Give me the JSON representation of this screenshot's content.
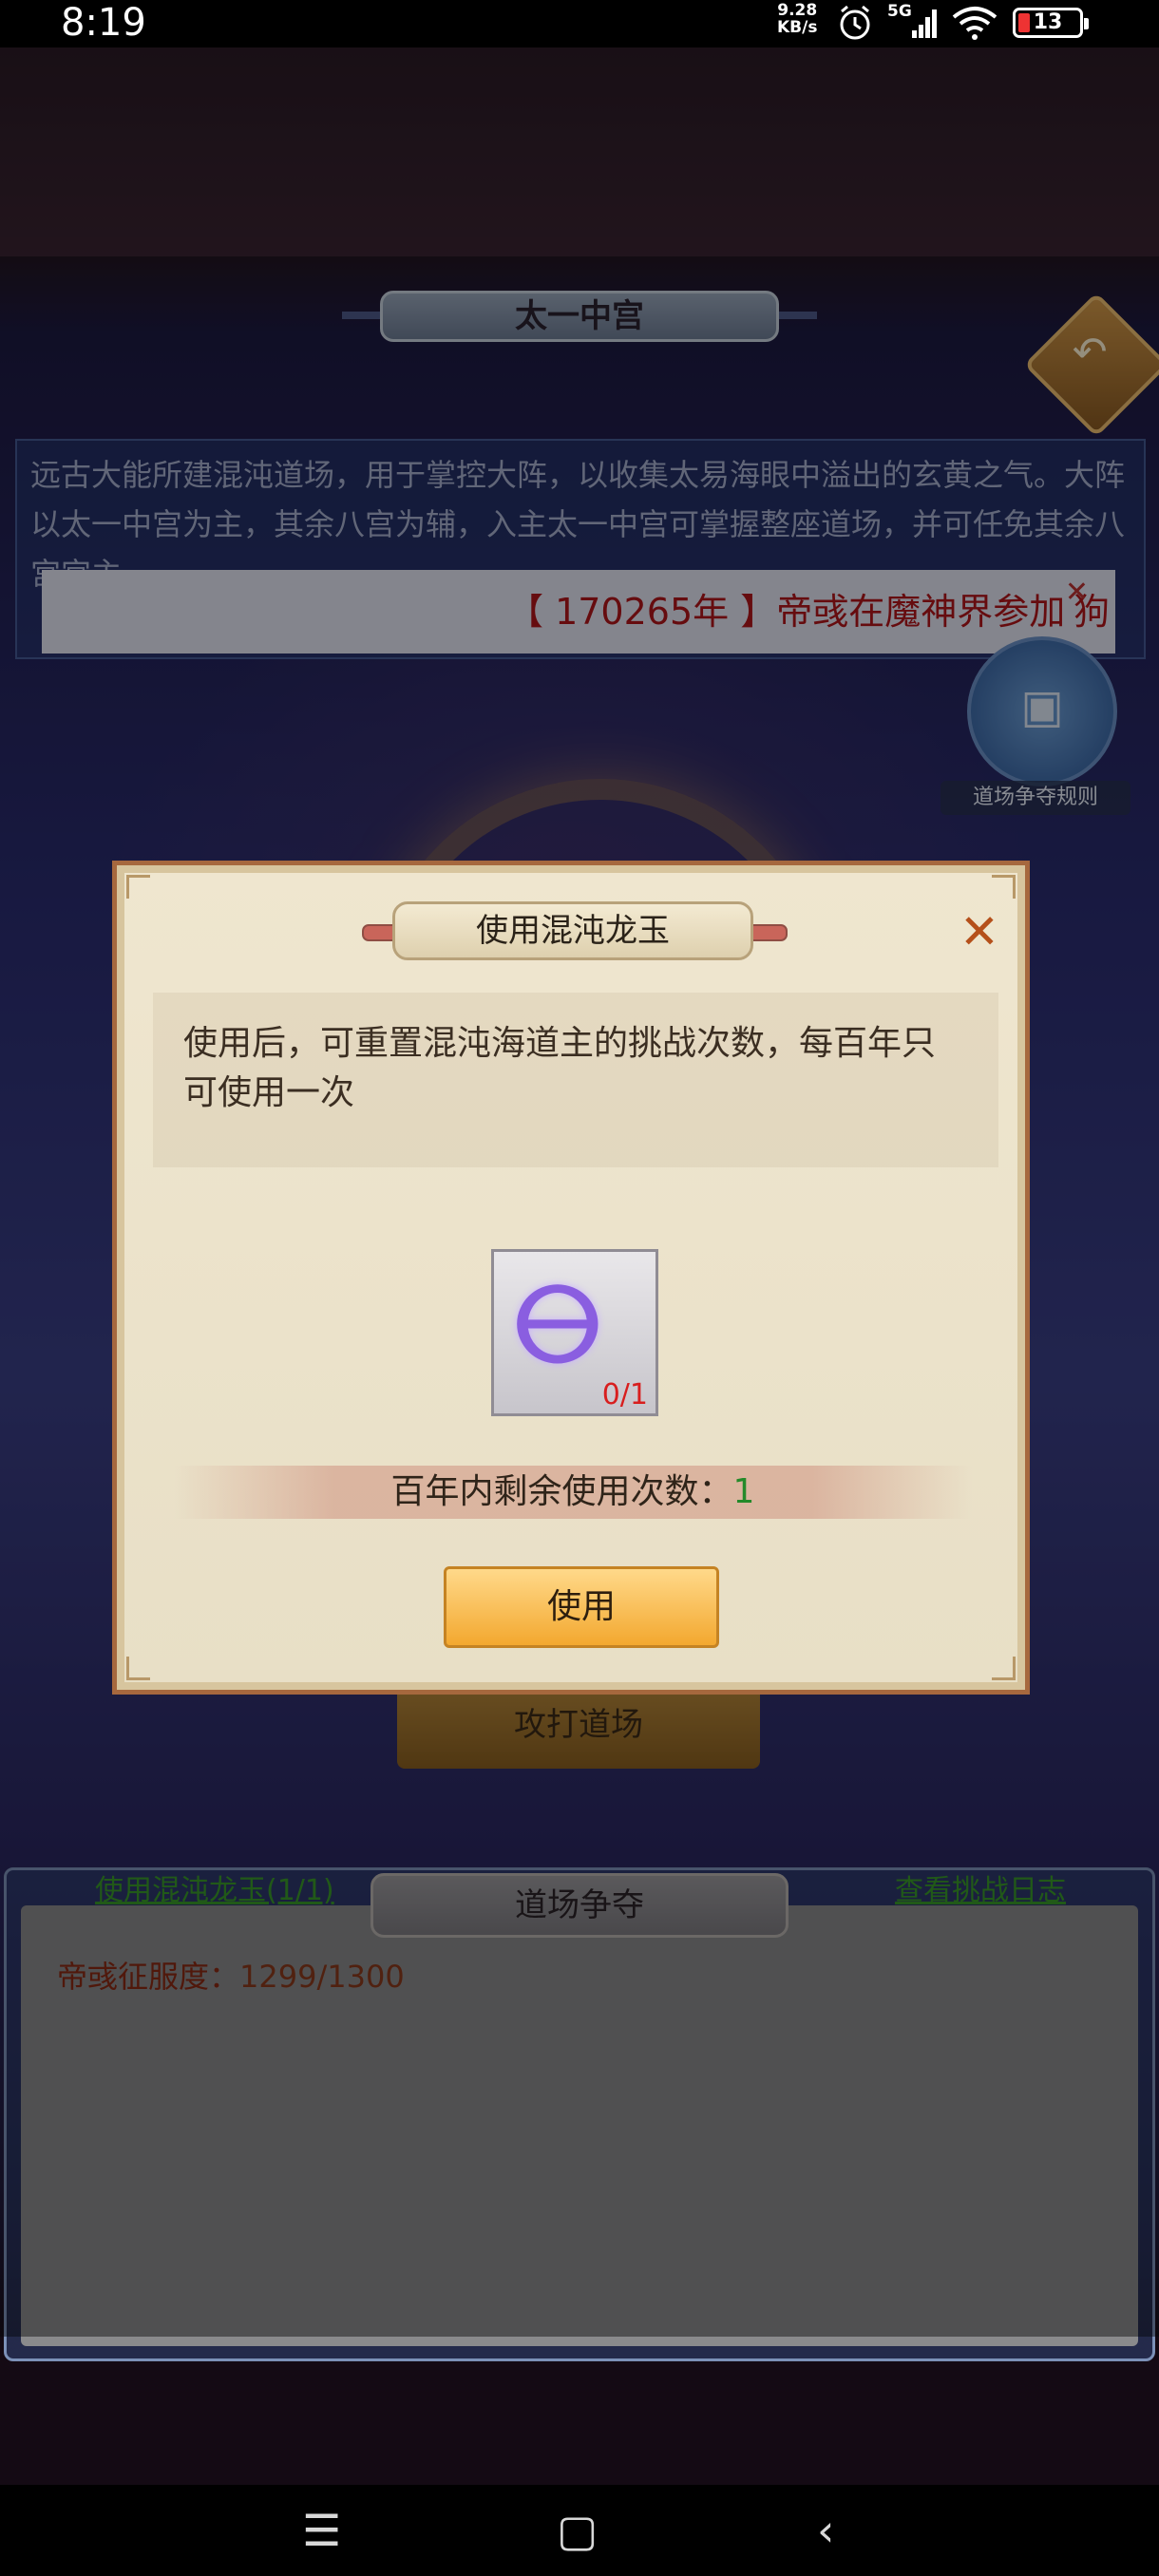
{
  "status_bar": {
    "time": "8:19",
    "net_speed_value": "9.28",
    "net_speed_unit": "KB/s",
    "network": "5G",
    "battery": "13"
  },
  "scene": {
    "title": "太一中宫",
    "description": "远古大能所建混沌道场，用于掌控大阵，以收集太易海眼中溢出的玄黄之气。大阵以太一中宫为主，其余八宫为辅，入主太一中宫可掌握整座道场，并可任免其余八宫宫主。",
    "broadcast_year": "【 170265年 】",
    "broadcast_rest": "帝彧在魔神界参加",
    "broadcast_cut": "狗",
    "rules_label": "道场争夺规则",
    "attack_label": "攻打道场"
  },
  "bottom_panel": {
    "use_jade_link": "使用混沌龙玉(1/1)",
    "tab_label": "道场争夺",
    "log_link": "查看挑战日志",
    "conquest_label": "帝彧征服度：",
    "conquest_value": "1299/1300"
  },
  "dialog": {
    "title": "使用混沌龙玉",
    "description": "使用后，可重置混沌海道主的挑战次数，每百年只可使用一次",
    "item_icon": "chaos-dragon-jade-icon",
    "item_count": "0/1",
    "remaining_label": "百年内剩余使用次数：",
    "remaining_value": "1",
    "use_button": "使用",
    "close_icon": "close-x-icon"
  },
  "colors": {
    "accent_orange": "#f3a82f",
    "close_orange": "#b5501a",
    "count_red": "#d81e1e",
    "remaining_green": "#248a2a",
    "broadcast_red": "#b0151a"
  }
}
